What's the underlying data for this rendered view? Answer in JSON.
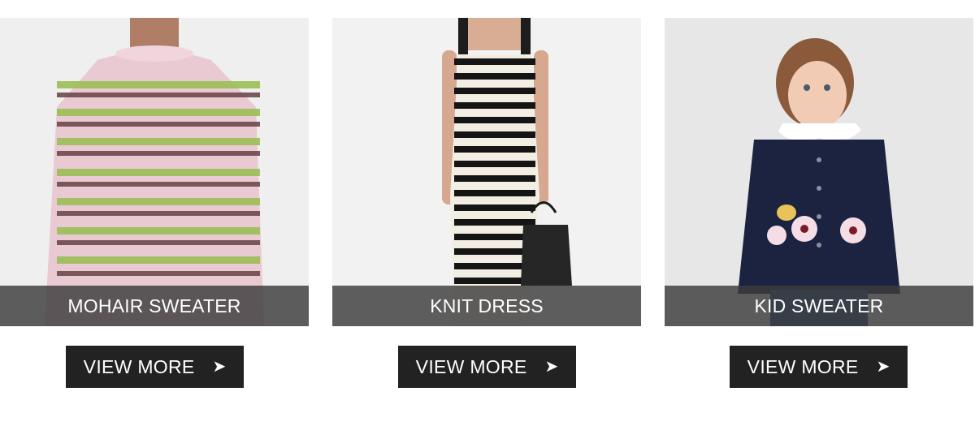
{
  "cards": [
    {
      "title": "MOHAIR SWEATER",
      "button_label": "VIEW MORE",
      "arrow": "➤",
      "image_icon": "striped-sweater-photo"
    },
    {
      "title": "KNIT DRESS",
      "button_label": "VIEW MORE",
      "arrow": "➤",
      "image_icon": "striped-dress-photo"
    },
    {
      "title": "KID SWEATER",
      "button_label": "VIEW MORE",
      "arrow": "➤",
      "image_icon": "kid-cardigan-photo"
    }
  ],
  "colors": {
    "caption_bar": "#3c3c3c",
    "button_bg": "#222222",
    "text": "#ffffff",
    "page_bg": "#ffffff"
  }
}
